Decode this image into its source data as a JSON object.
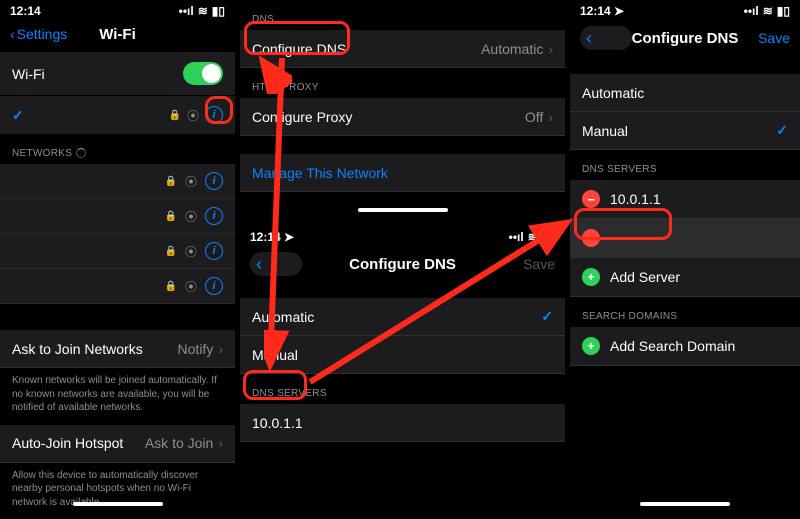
{
  "status": {
    "time": "12:14",
    "loc_glyph": "➤",
    "sig_glyph": "••ıl",
    "wifi_glyph": "≋",
    "batt_glyph": "▮▯"
  },
  "p1": {
    "back_label": "Settings",
    "title": "Wi-Fi",
    "wifi_label": "Wi-Fi",
    "networks_header": "Networks",
    "ask_label": "Ask to Join Networks",
    "ask_value": "Notify",
    "ask_foot": "Known networks will be joined automatically. If no known networks are available, you will be notified of available networks.",
    "auto_label": "Auto-Join Hotspot",
    "auto_value": "Ask to Join",
    "auto_foot": "Allow this device to automatically discover nearby personal hotspots when no Wi-Fi network is available."
  },
  "p2a": {
    "dns_header": "DNS",
    "conf_dns_label": "Configure DNS",
    "conf_dns_value": "Automatic",
    "proxy_header": "HTTP PROXY",
    "conf_proxy_label": "Configure Proxy",
    "conf_proxy_value": "Off",
    "manage_label": "Manage This Network"
  },
  "p2b": {
    "title": "Configure DNS",
    "save": "Save",
    "opt_auto": "Automatic",
    "opt_manual": "Manual",
    "servers_header": "DNS SERVERS",
    "server1": "10.0.1.1"
  },
  "p3": {
    "title": "Configure DNS",
    "save": "Save",
    "opt_auto": "Automatic",
    "opt_manual": "Manual",
    "servers_header": "DNS SERVERS",
    "server1": "10.0.1.1",
    "add_server": "Add Server",
    "domains_header": "SEARCH DOMAINS",
    "add_domain": "Add Search Domain"
  }
}
